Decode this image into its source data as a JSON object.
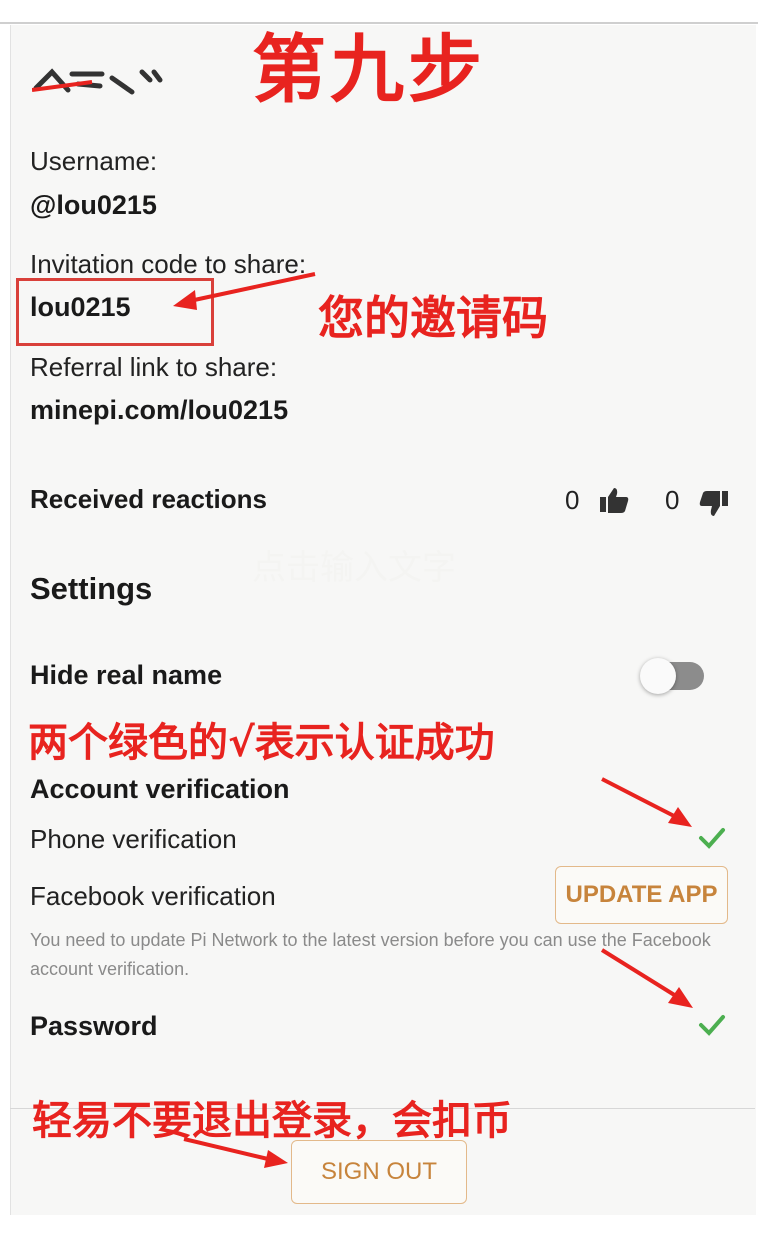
{
  "annotations": {
    "step_title": "第九步",
    "invite_code_note": "您的邀请码",
    "verification_note": "两个绿色的√表示认证成功",
    "signout_note": "轻易不要退出登录，会扣币",
    "watermark": "点击输入文字"
  },
  "profile": {
    "username_label": "Username:",
    "username_value": "@lou0215",
    "invitation_label": "Invitation code to share:",
    "invitation_value": "lou0215",
    "referral_label": "Referral link to share:",
    "referral_value": "minepi.com/lou0215"
  },
  "reactions": {
    "label": "Received reactions",
    "likes": "0",
    "dislikes": "0"
  },
  "settings": {
    "title": "Settings",
    "hide_real_name_label": "Hide real name",
    "hide_real_name_on": false
  },
  "verification": {
    "title": "Account verification",
    "phone_label": "Phone verification",
    "facebook_label": "Facebook verification",
    "update_button": "UPDATE APP",
    "facebook_note": "You need to update Pi Network to the latest version before you can use the Facebook account verification.",
    "password_label": "Password"
  },
  "signout_button": "SIGN OUT",
  "colors": {
    "annotation_red": "#e8231f",
    "check_green": "#4caf50",
    "button_orange": "#c7843c"
  }
}
